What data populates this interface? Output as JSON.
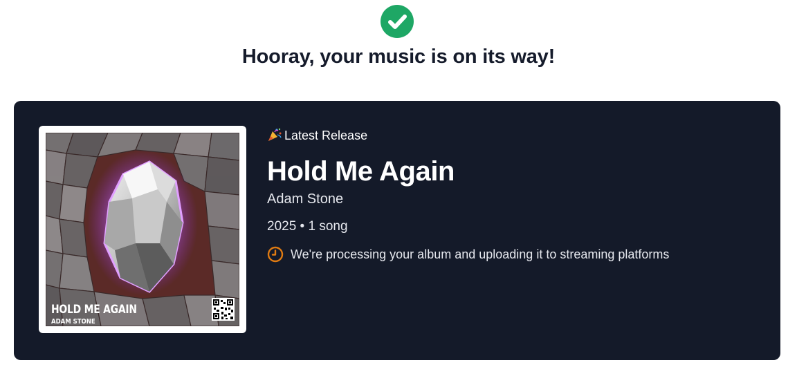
{
  "header": {
    "success_icon": "check-circle-icon",
    "success_color": "#1ea765",
    "headline": "Hooray, your music is on its way!"
  },
  "release": {
    "badge_icon": "party-popper-icon",
    "badge_label": "Latest Release",
    "title": "Hold Me Again",
    "artist": "Adam Stone",
    "meta": "2025 • 1 song",
    "status_icon": "clock-icon",
    "status_color": "#e07b12",
    "status_text": "We're processing your album and uploading it to streaming platforms",
    "cover": {
      "title": "HOLD ME AGAIN",
      "artist": "ADAM STONE",
      "qr_icon": "qr-code-icon"
    }
  },
  "colors": {
    "card_background": "#141a29",
    "headline_text": "#151b2b"
  }
}
